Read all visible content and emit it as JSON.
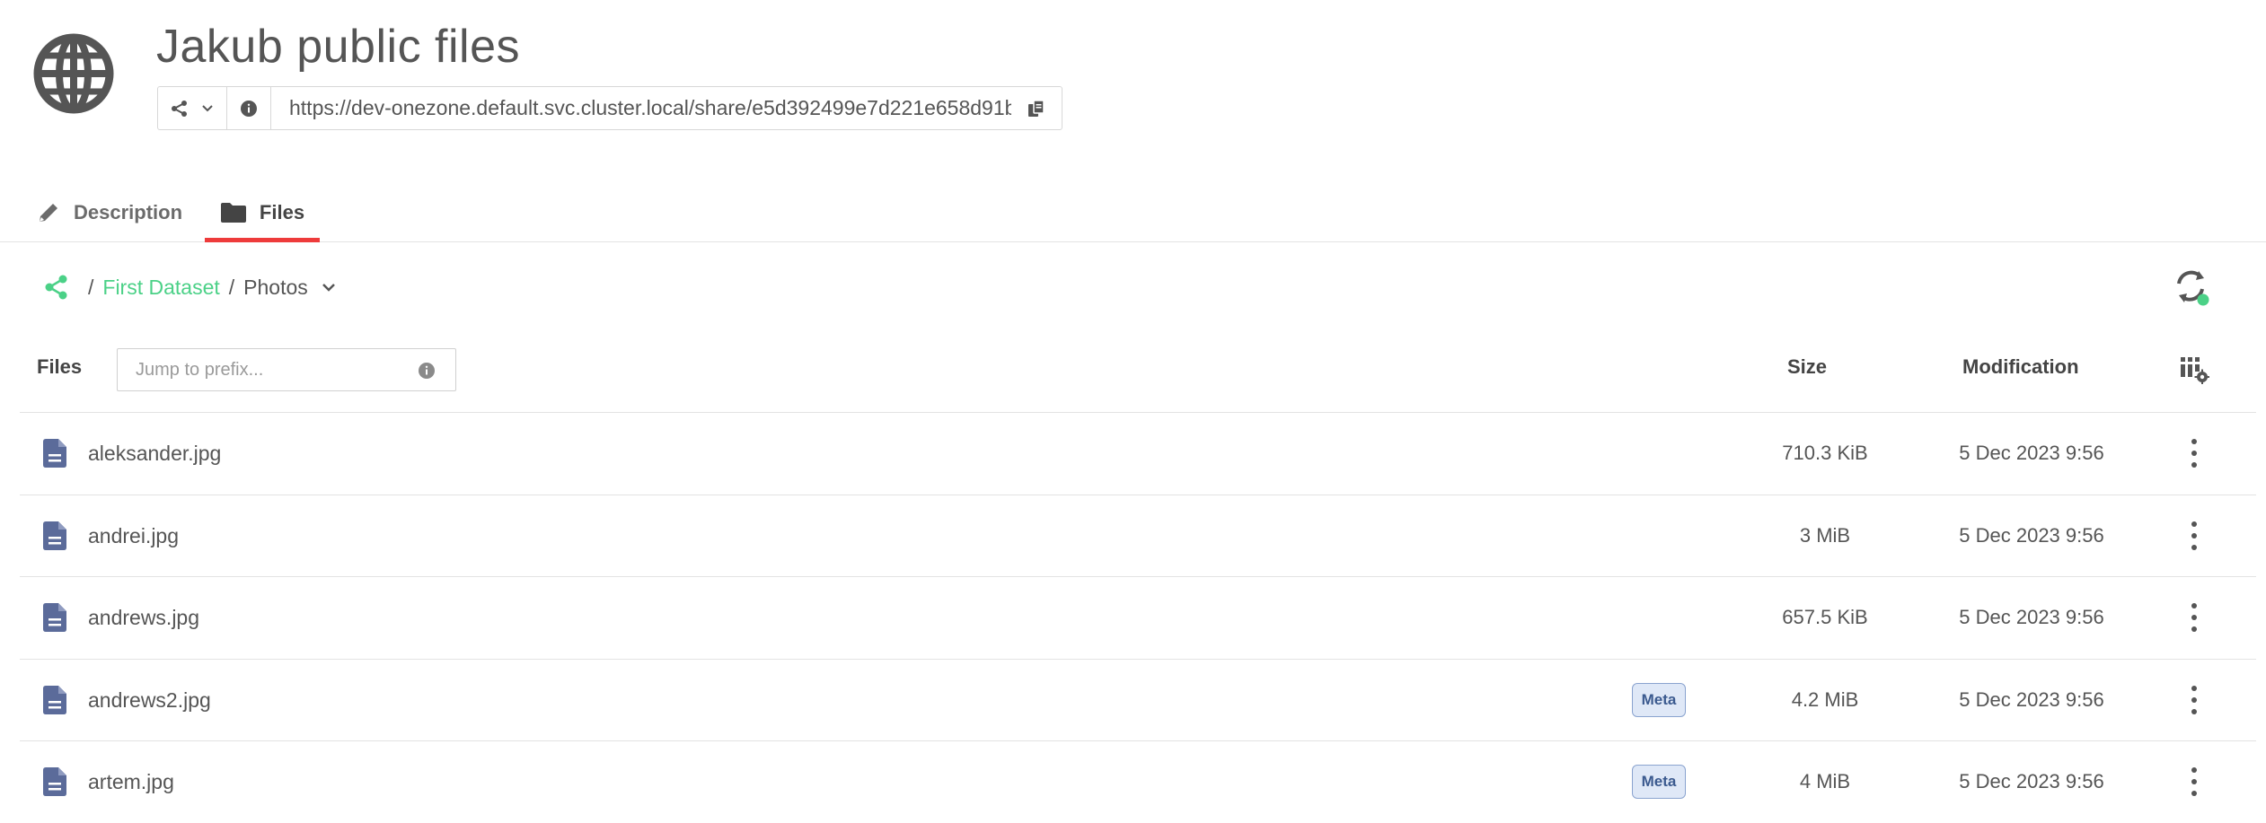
{
  "header": {
    "title": "Jakub public files",
    "url": "https://dev-onezone.default.svc.cluster.local/share/e5d392499e7d221e658d91b...",
    "icon": "globe-icon"
  },
  "tabs": [
    {
      "label": "Description",
      "icon": "pencil-icon",
      "active": false
    },
    {
      "label": "Files",
      "icon": "folder-icon",
      "active": true
    }
  ],
  "breadcrumb": {
    "root_icon": "share-icon",
    "items": [
      "First Dataset",
      "Photos"
    ],
    "separator": "/"
  },
  "table": {
    "files_header": "Files",
    "prefix_placeholder": "Jump to prefix...",
    "size_header": "Size",
    "modification_header": "Modification",
    "rows": [
      {
        "name": "aleksander.jpg",
        "meta": "",
        "size": "710.3 KiB",
        "modified": "5 Dec 2023 9:56"
      },
      {
        "name": "andrei.jpg",
        "meta": "",
        "size": "3 MiB",
        "modified": "5 Dec 2023 9:56"
      },
      {
        "name": "andrews.jpg",
        "meta": "",
        "size": "657.5 KiB",
        "modified": "5 Dec 2023 9:56"
      },
      {
        "name": "andrews2.jpg",
        "meta": "Meta",
        "size": "4.2 MiB",
        "modified": "5 Dec 2023 9:56"
      },
      {
        "name": "artem.jpg",
        "meta": "Meta",
        "size": "4 MiB",
        "modified": "5 Dec 2023 9:56"
      }
    ]
  },
  "colors": {
    "accent_green": "#4bd187",
    "active_tab_underline": "#ee3b3b",
    "file_icon": "#5b6b9a",
    "meta_badge_bg": "#dfe8f7"
  }
}
